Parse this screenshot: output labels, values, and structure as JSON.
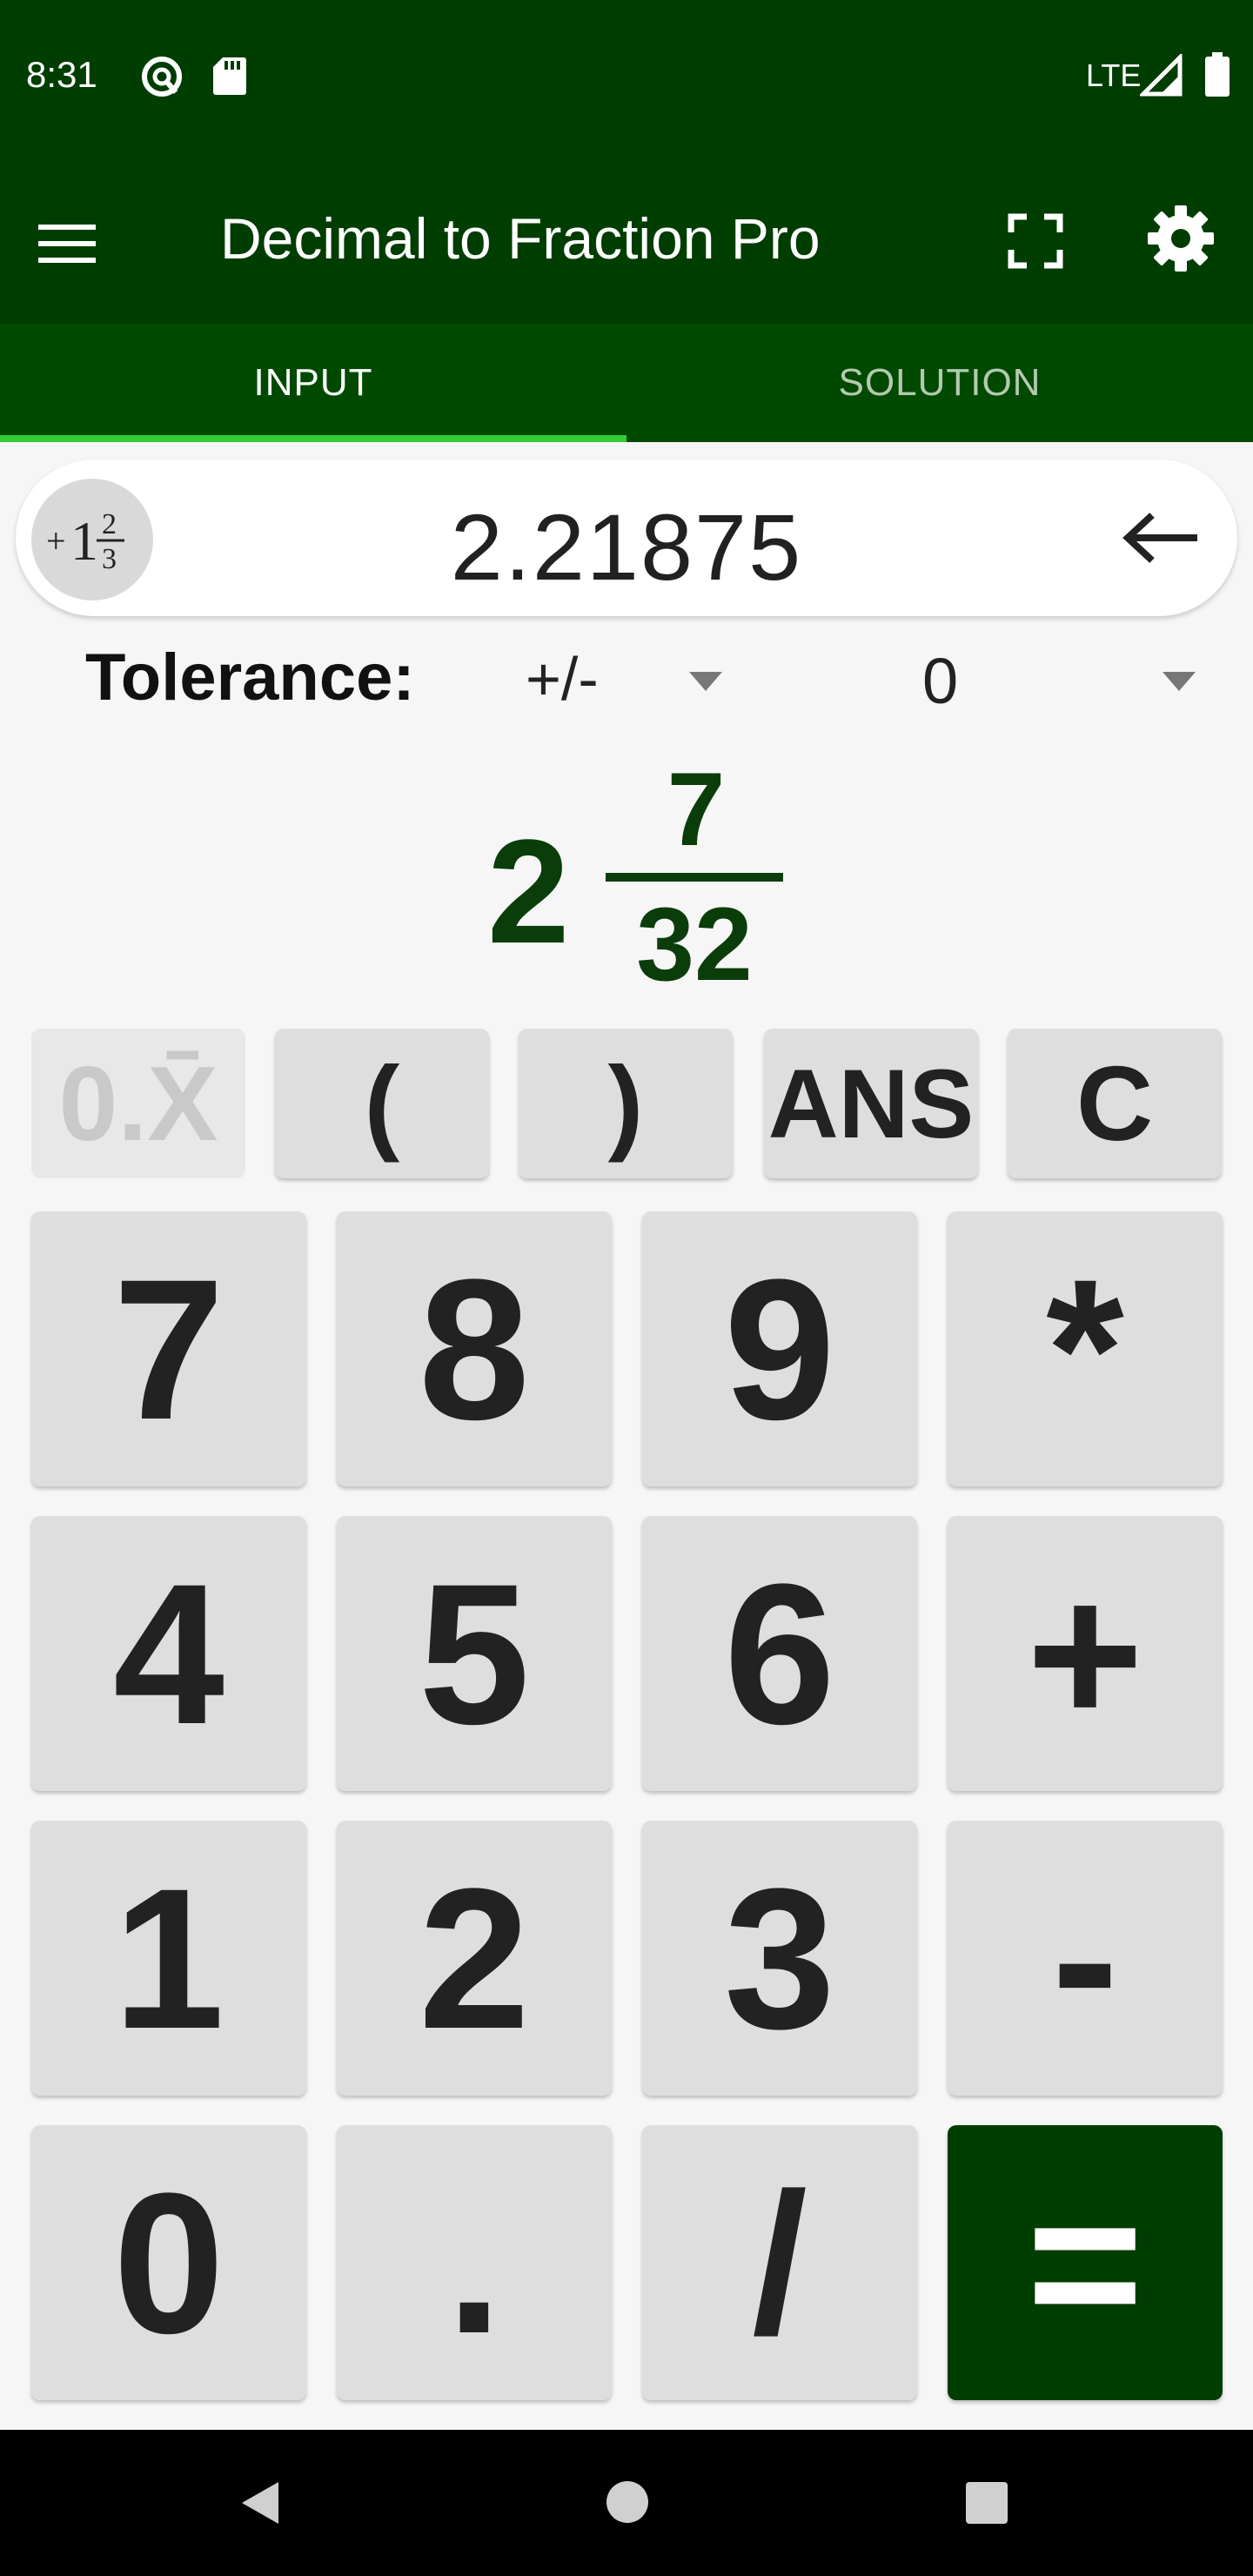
{
  "status_bar": {
    "time": "8:31",
    "network": "LTE"
  },
  "app_bar": {
    "title": "Decimal to Fraction Pro"
  },
  "tabs": [
    {
      "label": "INPUT",
      "active": true
    },
    {
      "label": "SOLUTION",
      "active": false
    }
  ],
  "input": {
    "value": "2.21875",
    "mode_icon": "mixed-fraction-icon"
  },
  "tolerance": {
    "label": "Tolerance:",
    "mode": "+/-",
    "value": "0"
  },
  "result": {
    "whole": "2",
    "numerator": "7",
    "denominator": "32"
  },
  "keys": {
    "repeat": "0.X̄",
    "open_paren": "(",
    "close_paren": ")",
    "ans": "ANS",
    "clear": "C",
    "k7": "7",
    "k8": "8",
    "k9": "9",
    "mul": "*",
    "k4": "4",
    "k5": "5",
    "k6": "6",
    "add": "+",
    "k1": "1",
    "k2": "2",
    "k3": "3",
    "sub": "-",
    "k0": "0",
    "dot": ".",
    "div": "/",
    "eq": "="
  },
  "colors": {
    "primary": "#003d00",
    "tab_bar": "#004a00",
    "accent": "#33cc33",
    "result_text": "#0a3d0a"
  }
}
